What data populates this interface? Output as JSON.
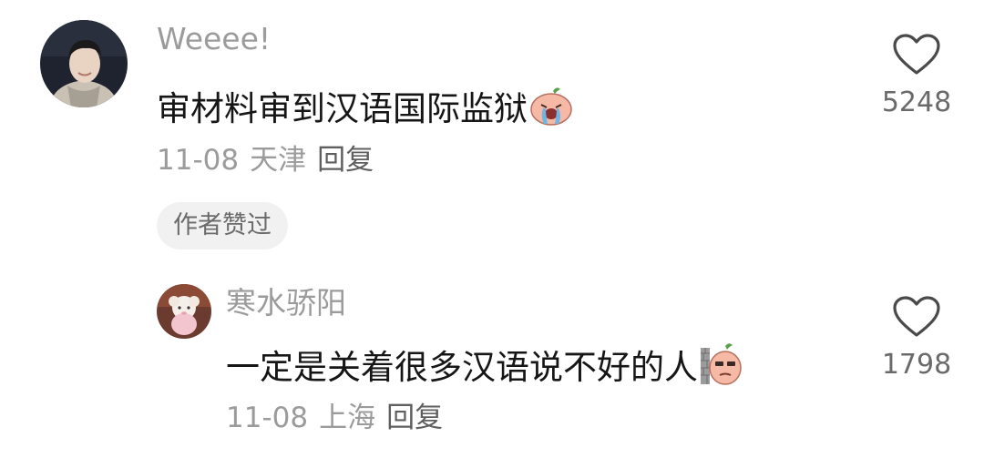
{
  "comments": [
    {
      "username": "Weeee!",
      "text": "审材料审到汉语国际监狱",
      "emoji": "crying-face-sticker-icon",
      "date": "11-08",
      "location": "天津",
      "reply_label": "回复",
      "badge": "作者赞过",
      "like_count": "5248"
    },
    {
      "username": "寒水骄阳",
      "text": "一定是关着很多汉语说不好的人",
      "emoji": "peeking-face-sticker-icon",
      "date": "11-08",
      "location": "上海",
      "reply_label": "回复",
      "like_count": "1798"
    }
  ],
  "colors": {
    "username": "#9b9b9b",
    "text": "#161616",
    "meta": "#9b9b9b",
    "reply": "#5f5f5f",
    "badge_bg": "#f1f1f1",
    "heart": "#4a4a4a"
  }
}
